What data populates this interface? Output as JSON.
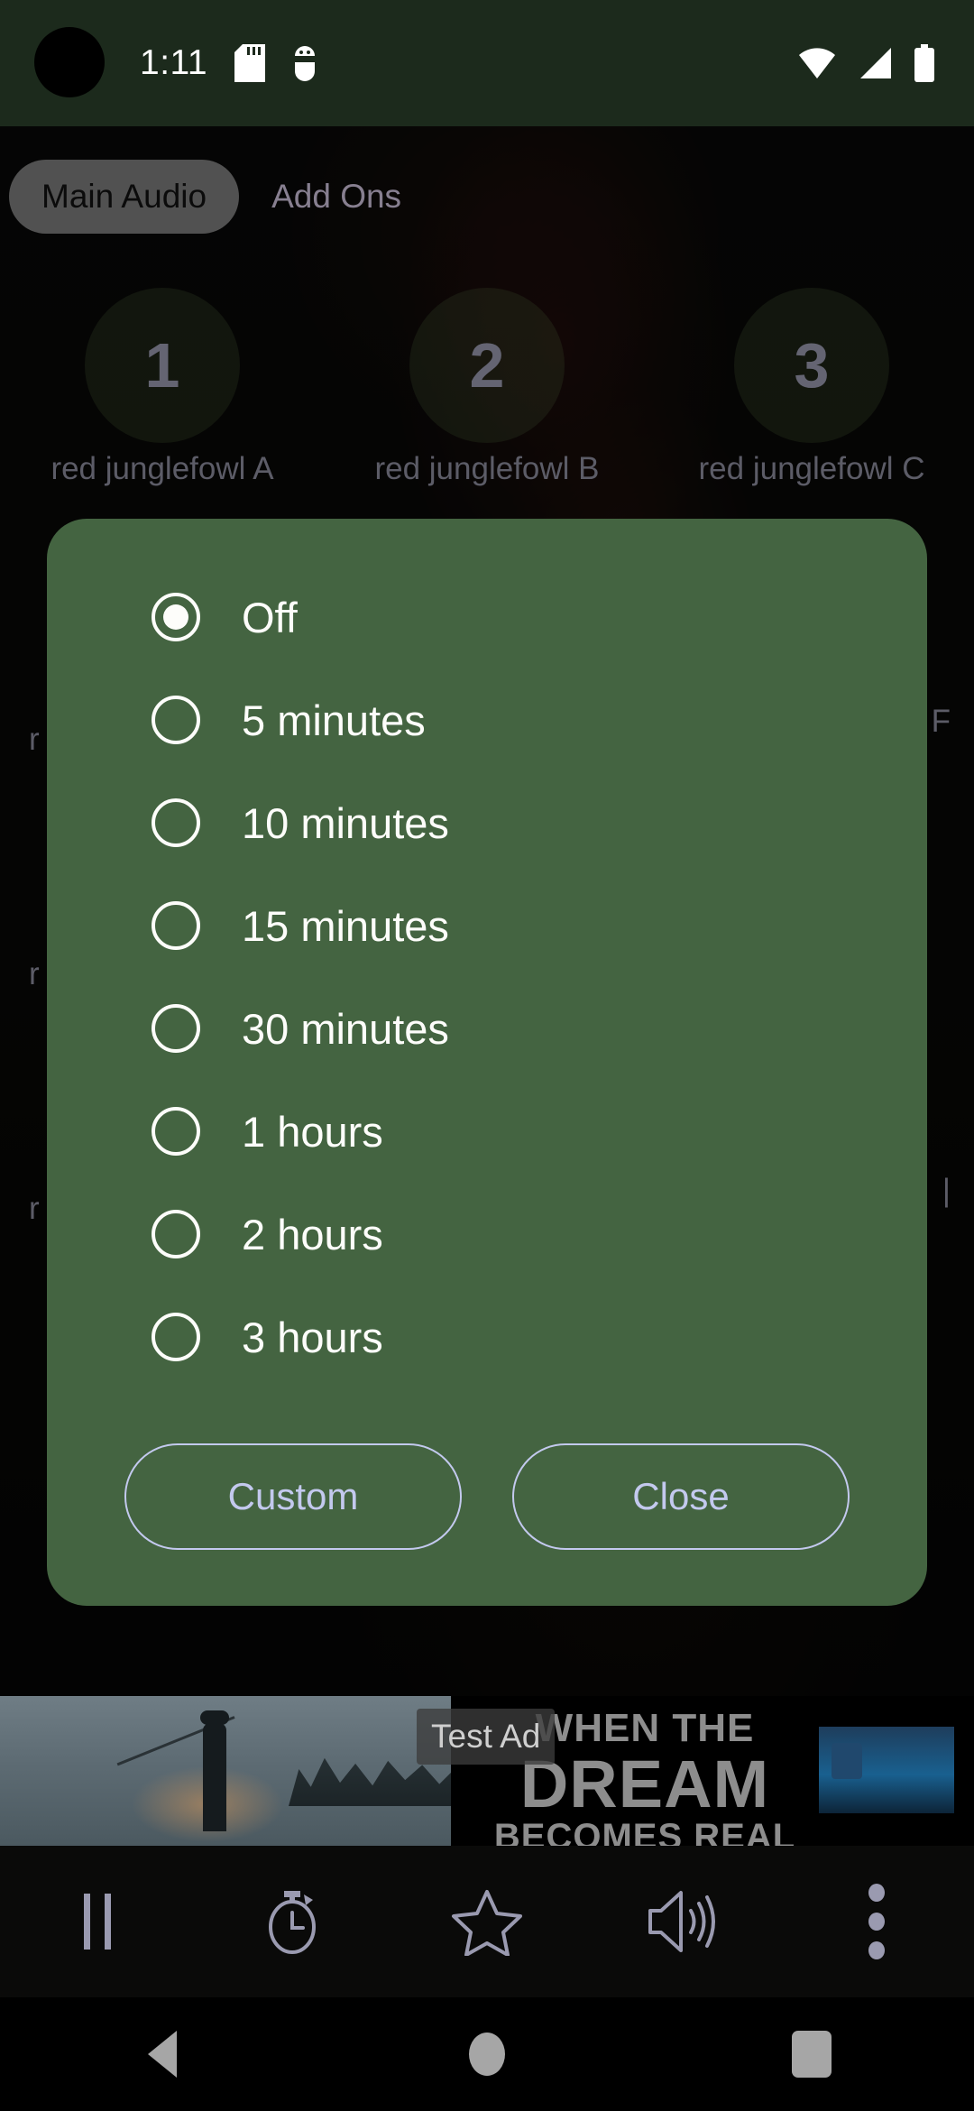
{
  "status_bar": {
    "time": "1:11",
    "icons": [
      "sd-card-icon",
      "android-debug-icon",
      "wifi-icon",
      "cellular-signal-icon",
      "battery-icon"
    ]
  },
  "tabs": [
    {
      "label": "Main Audio",
      "selected": true
    },
    {
      "label": "Add Ons",
      "selected": false
    }
  ],
  "sound_slots": [
    {
      "number": "1",
      "label": "red junglefowl A"
    },
    {
      "number": "2",
      "label": "red junglefowl B"
    },
    {
      "number": "3",
      "label": "red junglefowl C"
    }
  ],
  "background_peek": {
    "left_1": "r",
    "left_2": "r",
    "left_3": "r",
    "right_1": "F",
    "right_2": "|"
  },
  "dialog": {
    "options": [
      {
        "label": "Off",
        "selected": true
      },
      {
        "label": "5 minutes",
        "selected": false
      },
      {
        "label": "10 minutes",
        "selected": false
      },
      {
        "label": "15 minutes",
        "selected": false
      },
      {
        "label": "30 minutes",
        "selected": false
      },
      {
        "label": "1 hours",
        "selected": false
      },
      {
        "label": "2 hours",
        "selected": false
      },
      {
        "label": "3 hours",
        "selected": false
      }
    ],
    "custom_label": "Custom",
    "close_label": "Close"
  },
  "ad": {
    "badge": "Test Ad",
    "line1": "WHEN THE",
    "line2": "DREAM",
    "line3": "BECOMES REAL"
  },
  "toolbar": {
    "items": [
      {
        "name": "pause-icon"
      },
      {
        "name": "sleep-timer-icon"
      },
      {
        "name": "favorite-star-icon"
      },
      {
        "name": "volume-icon"
      },
      {
        "name": "overflow-menu-icon"
      }
    ]
  },
  "navigation_bar": {
    "back": "back-icon",
    "home": "home-icon",
    "recents": "recents-icon"
  },
  "colors": {
    "status_bar_bg": "#1c2a1c",
    "dialog_bg": "#446441",
    "dialog_text": "#fdfdfa",
    "accent_lavender": "#c3c9ee",
    "tab_selected_bg": "#7d7d7d",
    "muted_text": "#8e8e9e"
  }
}
